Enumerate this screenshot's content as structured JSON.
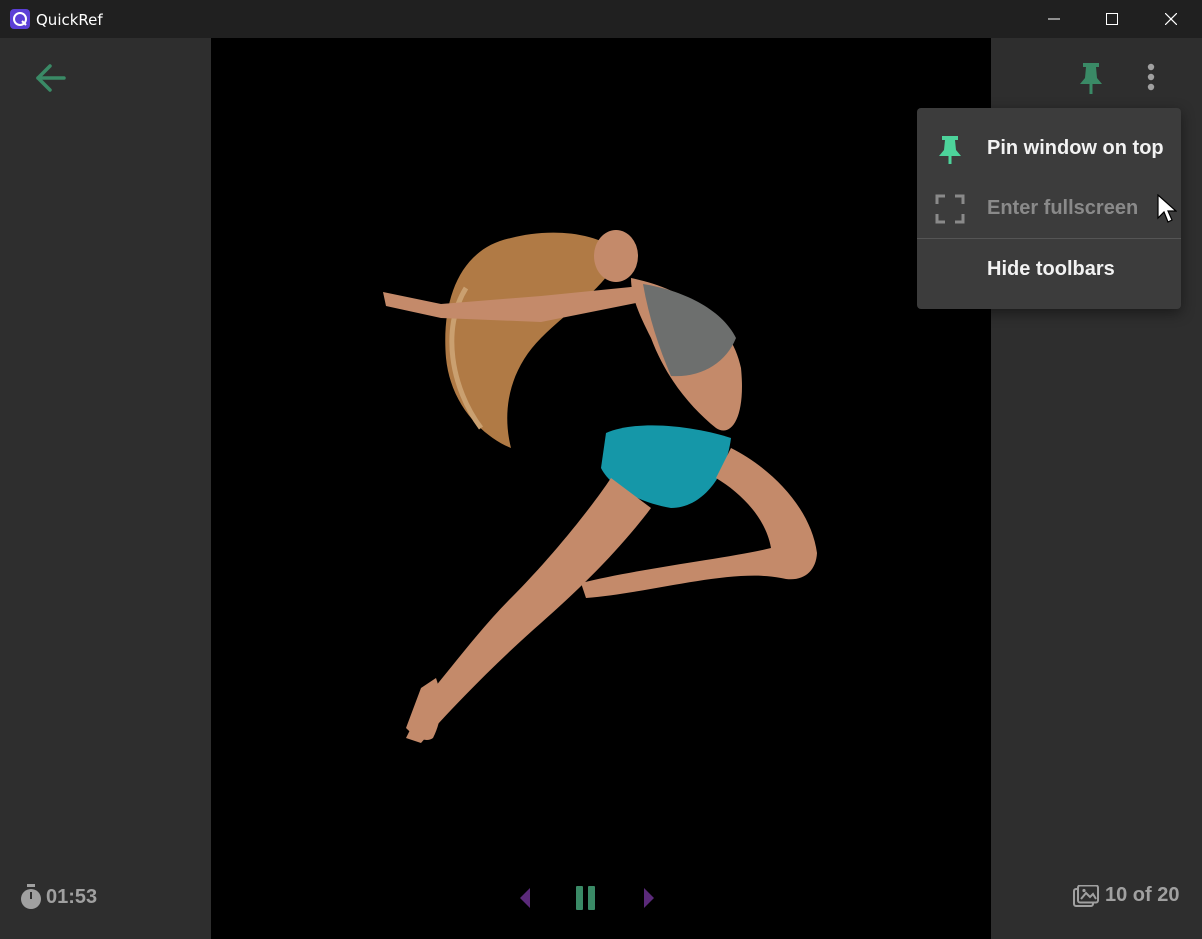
{
  "titlebar": {
    "app_name": "QuickRef",
    "icons": [
      "app-logo-icon",
      "minimize-icon",
      "maximize-icon",
      "close-icon"
    ]
  },
  "left_toolbar": {
    "back_icon": "arrow-left-icon",
    "timer_icon": "stopwatch-icon",
    "timer_value": "01:53"
  },
  "right_toolbar": {
    "pin_icon": "pushpin-icon",
    "more_icon": "more-vertical-icon",
    "counter_icon": "image-gallery-icon",
    "counter_text": "10 of 20"
  },
  "playback": {
    "previous_icon": "triangle-left-icon",
    "pause_icon": "pause-icon",
    "next_icon": "triangle-right-icon"
  },
  "menu": {
    "items": [
      {
        "label": "Pin window on top",
        "icon": "pushpin-icon",
        "enabled": true
      },
      {
        "label": "Enter fullscreen",
        "icon": "fullscreen-icon",
        "enabled": false
      },
      {
        "label": "Hide toolbars",
        "icon": "",
        "enabled": true
      }
    ]
  },
  "colors": {
    "accent_green": "#4dd39b",
    "accent_green_dim": "#3a8a66",
    "accent_purple": "#5b2a7a",
    "panel_bg": "#2e2e2e",
    "titlebar_bg": "#202020",
    "menu_bg": "#3c3c3c",
    "text_light": "#f2f2f2",
    "text_disabled": "#8a8a8a",
    "text_muted": "#a0a0a0"
  },
  "photo": {
    "subject": "reference-photo"
  }
}
